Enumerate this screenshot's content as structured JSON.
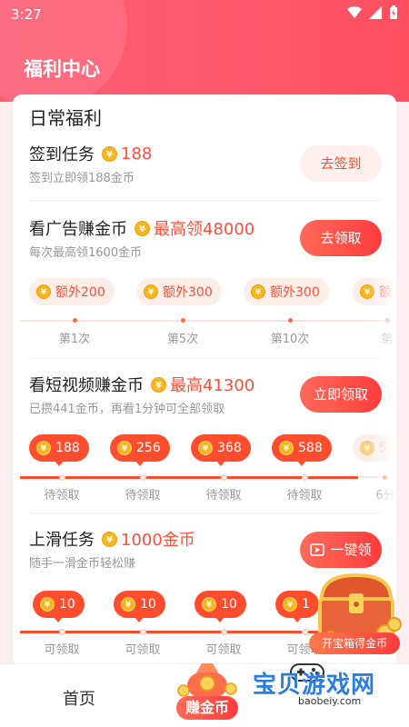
{
  "status": {
    "time": "3:27"
  },
  "header": {
    "title": "福利中心"
  },
  "section": {
    "title": "日常福利"
  },
  "signin": {
    "title": "签到任务",
    "reward": "188",
    "sub": "签到立即领188金币",
    "button": "去签到"
  },
  "ad": {
    "title": "看广告赚金币",
    "reward": "最高领48000",
    "sub": "每次最高领1600金币",
    "button": "去领取",
    "steps": [
      {
        "chip": "额外200",
        "label": "第1次"
      },
      {
        "chip": "额外300",
        "label": "第5次"
      },
      {
        "chip": "额外300",
        "label": "第10次"
      },
      {
        "chip": "额",
        "label": "第"
      }
    ]
  },
  "video": {
    "title": "看短视频赚金币",
    "reward": "最高41300",
    "sub": "已攒441金币，再看1分钟可全部领取",
    "button": "立即领取",
    "steps": [
      {
        "chip": "188",
        "label": "待领取"
      },
      {
        "chip": "256",
        "label": "待领取"
      },
      {
        "chip": "368",
        "label": "待领取"
      },
      {
        "chip": "588",
        "label": "待领取"
      },
      {
        "chip": "5",
        "label": "6分"
      }
    ]
  },
  "swipe": {
    "title": "上滑任务",
    "reward": "1000金币",
    "sub": "随手一滑金币轻松赚",
    "button": "一键领",
    "steps": [
      {
        "chip": "10",
        "label": "可领取"
      },
      {
        "chip": "10",
        "label": "可领取"
      },
      {
        "chip": "10",
        "label": "可领取"
      },
      {
        "chip": "1",
        "label": "可领取"
      }
    ]
  },
  "chest": {
    "label": "开宝箱得金币"
  },
  "nav": {
    "home": "首页",
    "earn": "赚金币"
  },
  "watermark": {
    "name": "宝贝游戏网",
    "url": "baobeiy.com"
  },
  "colors": {
    "accent": "#ff4e3a",
    "header": "#fb5d72",
    "coin": "#f6b61e"
  }
}
